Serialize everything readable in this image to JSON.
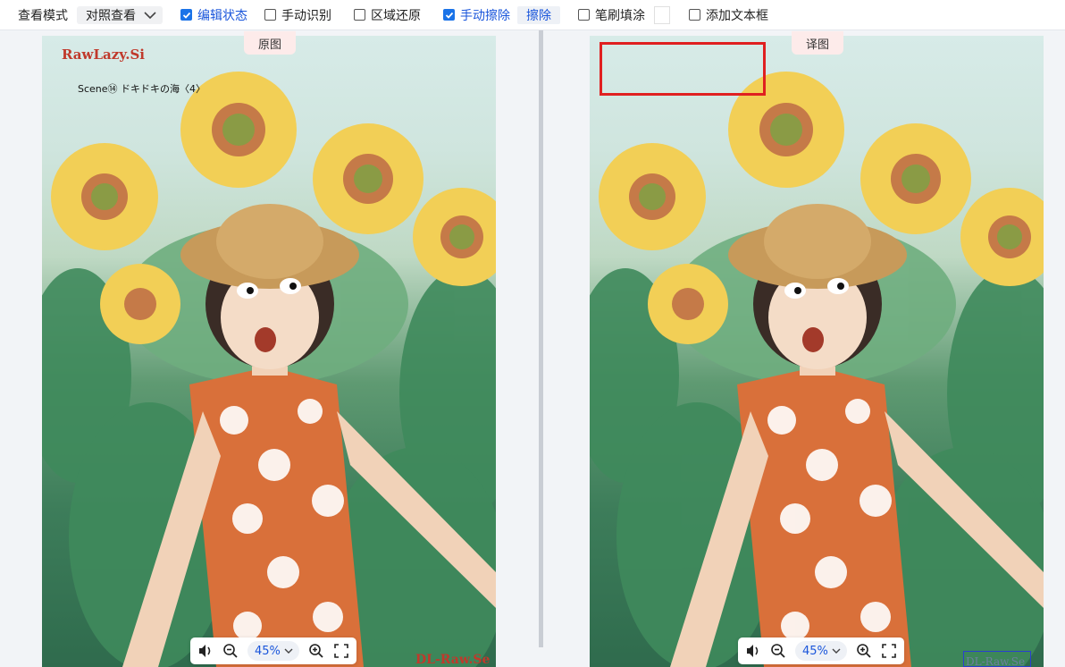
{
  "toolbar": {
    "view_mode_label": "查看模式",
    "view_mode_value": "对照查看",
    "edit_state": "编辑状态",
    "manual_detect": "手动识别",
    "region_restore": "区域还原",
    "manual_erase": "手动擦除",
    "erase_button": "擦除",
    "brush_fill": "笔刷填涂",
    "add_textbox": "添加文本框"
  },
  "checks": {
    "edit_state": true,
    "manual_detect": false,
    "region_restore": false,
    "manual_erase": true,
    "brush_fill": false,
    "add_textbox": false
  },
  "left_panel": {
    "tag": "原图",
    "watermark_top": "RawLazy.Si",
    "scene_caption": "Scene⑭ ドキドキの海〈4〉",
    "watermark_bottom": "DL-Raw.Se",
    "zoom": "45%"
  },
  "right_panel": {
    "tag": "译图",
    "watermark_bottom": "DL-Raw.Se",
    "zoom": "45%"
  },
  "colors": {
    "accent": "#1a73e8",
    "selection": "#e02020",
    "tag_bg": "#fdebea"
  }
}
